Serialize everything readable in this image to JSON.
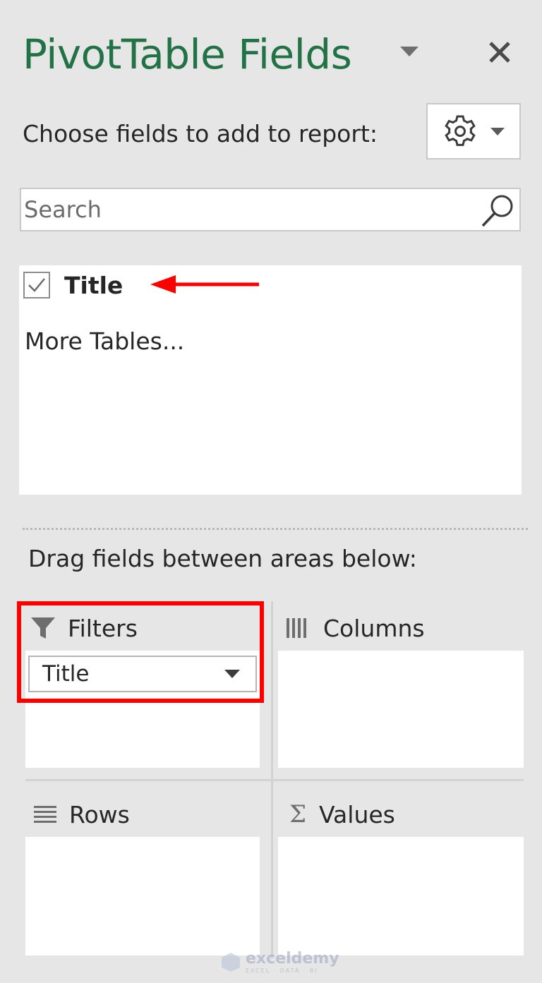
{
  "pane": {
    "title": "PivotTable Fields",
    "choose_label": "Choose fields to add to report:",
    "search_placeholder": "Search",
    "fields": [
      {
        "label": "Title",
        "checked": true
      }
    ],
    "more_tables": "More Tables...",
    "drag_label": "Drag fields between areas below:"
  },
  "areas": {
    "filters": {
      "label": "Filters",
      "items": [
        "Title"
      ]
    },
    "columns": {
      "label": "Columns"
    },
    "rows": {
      "label": "Rows"
    },
    "values": {
      "label": "Values",
      "icon_glyph": "Σ"
    }
  },
  "watermark": {
    "name": "exceldemy",
    "tagline": "EXCEL · DATA · BI"
  },
  "colors": {
    "title": "#217346",
    "annotation": "#ff0000",
    "panel_bg": "#e6e6e6"
  },
  "icons": [
    "chevron-down-icon",
    "close-icon",
    "gear-icon",
    "search-icon",
    "check-icon",
    "filter-icon",
    "columns-icon",
    "rows-icon",
    "sigma-icon"
  ]
}
